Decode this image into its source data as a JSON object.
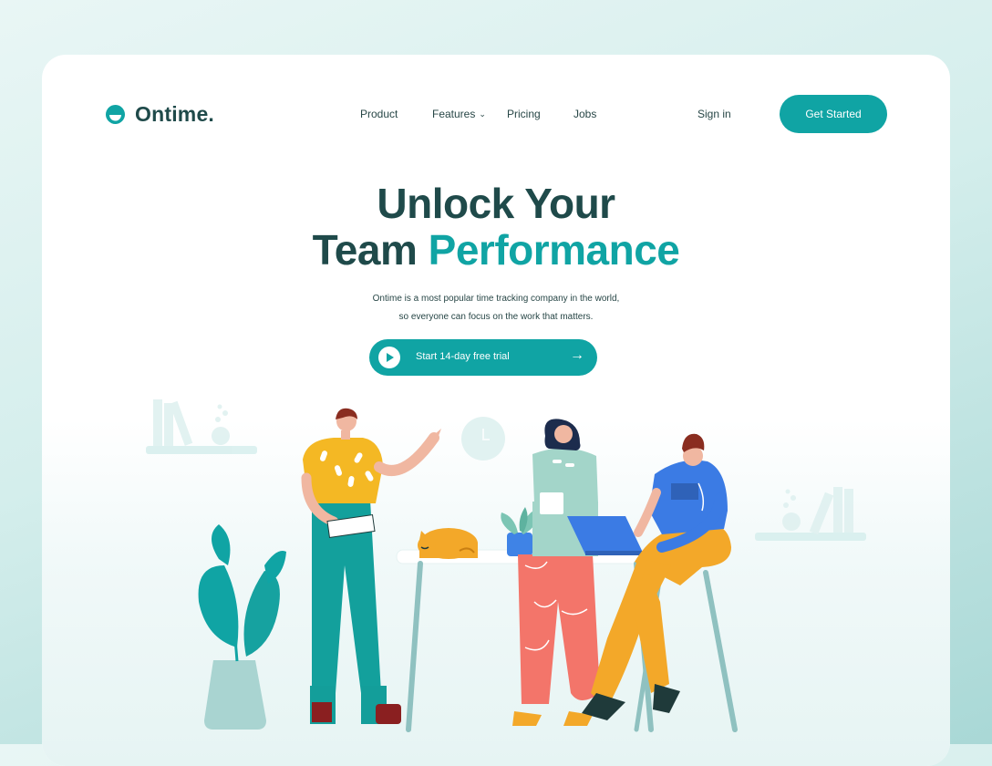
{
  "brand": {
    "name": "Ontime."
  },
  "nav": {
    "items": [
      {
        "label": "Product"
      },
      {
        "label": "Features"
      },
      {
        "label": "Pricing"
      },
      {
        "label": "Jobs"
      }
    ],
    "features_chevron": "⌄"
  },
  "header": {
    "sign_in": "Sign in",
    "get_started": "Get Started"
  },
  "hero": {
    "title_line1": "Unlock Your",
    "title_line2_plain": "Team",
    "title_line2_accent": "Performance",
    "subtitle_line1": "Ontime is a most popular time tracking company in the world,",
    "subtitle_line2": "so everyone can focus on the work that matters.",
    "trial_label": "Start 14-day free trial",
    "trial_arrow": "→"
  },
  "colors": {
    "brand_teal": "#10a4a4",
    "heading_dark": "#1f4a4a",
    "text": "#274646"
  },
  "icons": [
    "brand-logo-icon",
    "chevron-down-icon",
    "play-icon",
    "arrow-right-icon"
  ]
}
